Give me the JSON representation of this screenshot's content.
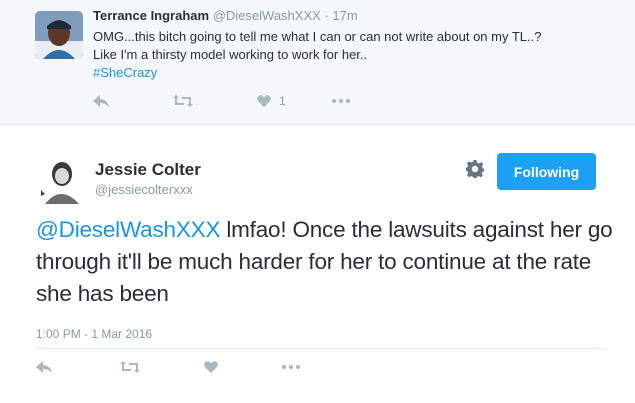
{
  "parent_tweet": {
    "author_name": "Terrance Ingraham",
    "author_handle": "@DieselWashXXX",
    "separator": "·",
    "time": "17m",
    "text_line1": "OMG...this bitch going to tell me what I can or can not write about on my TL..?",
    "text_line2": "Like I'm a thirsty model working to work for her..",
    "hashtag": "#SheCrazy",
    "like_count": "1",
    "actions": [
      "reply-icon",
      "retweet-icon",
      "heart-icon",
      "more-icon"
    ]
  },
  "main_tweet": {
    "author_name": "Jessie Colter",
    "author_handle": "@jessiecolterxxx",
    "follow_label": "Following",
    "mention": "@DieselWashXXX",
    "text": " lmfao! Once the lawsuits against her go through it'll be much harder for her to continue at the rate she has been",
    "timestamp": "1:00 PM - 1 Mar 2016",
    "actions": [
      "reply-icon",
      "retweet-icon",
      "heart-icon",
      "more-icon"
    ]
  },
  "colors": {
    "accent": "#1da1f2",
    "link": "#1b95e0",
    "muted": "#8899a6",
    "icon": "#aab8c2",
    "text": "#292f33"
  }
}
